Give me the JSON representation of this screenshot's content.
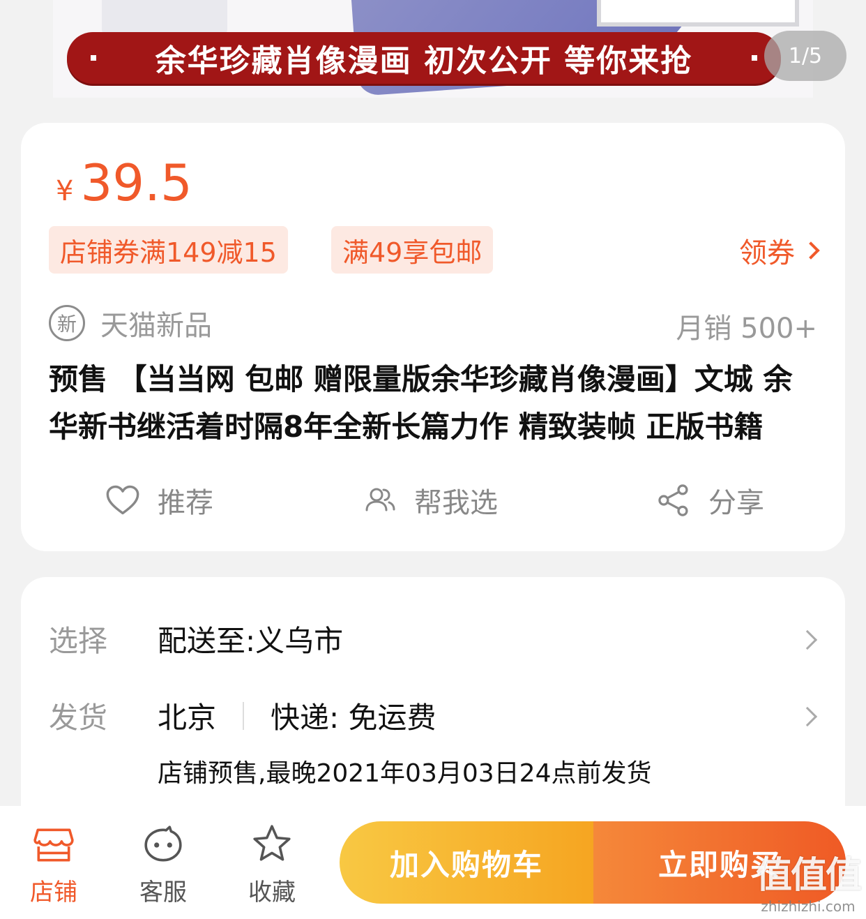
{
  "banner": {
    "ribbon_text": "余华珍藏肖像漫画 初次公开 等你来抢",
    "pager": "1/5"
  },
  "price": {
    "currency": "¥",
    "value": "39.5"
  },
  "tags": [
    "店铺券满149减15",
    "满49享包邮"
  ],
  "coupon_label": "领券",
  "new_badge": "新",
  "new_label": "天猫新品",
  "monthly_sales": "月销 500+",
  "product_title": "预售 【当当网 包邮 赠限量版余华珍藏肖像漫画】文城 余华新书继活着时隔8年全新长篇力作 精致装帧 正版书籍",
  "actions": {
    "recommend": "推荐",
    "help_choose": "帮我选",
    "share": "分享"
  },
  "select": {
    "label": "选择",
    "value": "配送至:义乌市"
  },
  "ship": {
    "label": "发货",
    "origin": "北京",
    "express": "快递: 免运费",
    "presale_note": "店铺预售,最晚2021年03月03日24点前发货"
  },
  "bottom_nav": {
    "store": "店铺",
    "service": "客服",
    "favorite": "收藏"
  },
  "buttons": {
    "add_to_cart": "加入购物车",
    "buy_now": "立即购买"
  },
  "watermark": {
    "brand": "值值值",
    "url": "zhizhizhi.com"
  },
  "colors": {
    "accent": "#f0592a",
    "cart_start": "#f8c843",
    "buy_end": "#ef5a25"
  }
}
